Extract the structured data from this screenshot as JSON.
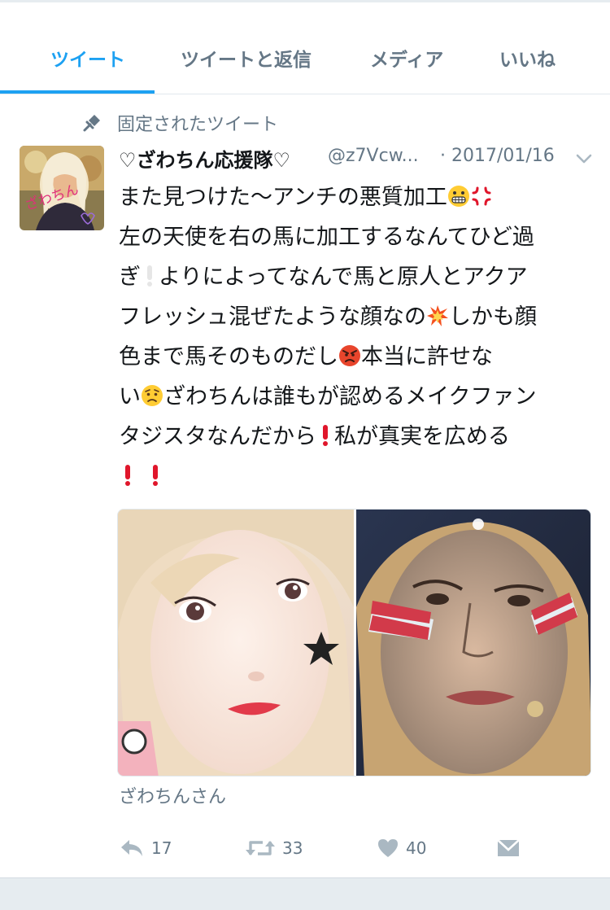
{
  "tabs": [
    {
      "label": "ツイート",
      "active": true
    },
    {
      "label": "ツイートと返信",
      "active": false
    },
    {
      "label": "メディア",
      "active": false
    },
    {
      "label": "いいね",
      "active": false
    }
  ],
  "pinned_label": "固定されたツイート",
  "tweet": {
    "display_name": "♡ざわちん応援隊♡",
    "handle": "@z7Vcw...",
    "date": "· 2017/01/16",
    "lines": [
      "また見つけた〜アンチの悪質加工",
      "左の天使を右の馬に加工するなんてひど過",
      "ぎ",
      "よりによってなんで馬と原人とアクア",
      "フレッシュ混ぜたような顔なの",
      "しかも顔",
      "色まで馬そのものだし",
      "本当に許せな",
      "い",
      "ざわちんは誰もが認めるメイクファン",
      "タジスタなんだから",
      "私が真実を広める"
    ],
    "avatar_overlay_text": "ざわちん",
    "media_caption": "ざわちんさん",
    "reply_count": "17",
    "retweet_count": "33",
    "like_count": "40"
  },
  "icons": {
    "pin": "pin-icon",
    "caret": "chevron-down-icon",
    "reply": "reply-icon",
    "retweet": "retweet-icon",
    "like": "heart-icon",
    "dm": "envelope-icon"
  },
  "colors": {
    "accent": "#1da1f2",
    "secondary_text": "#657786",
    "divider": "#e1e8ed",
    "icon_gray": "#aab8c2",
    "exclamation_red": "#e0162b"
  }
}
